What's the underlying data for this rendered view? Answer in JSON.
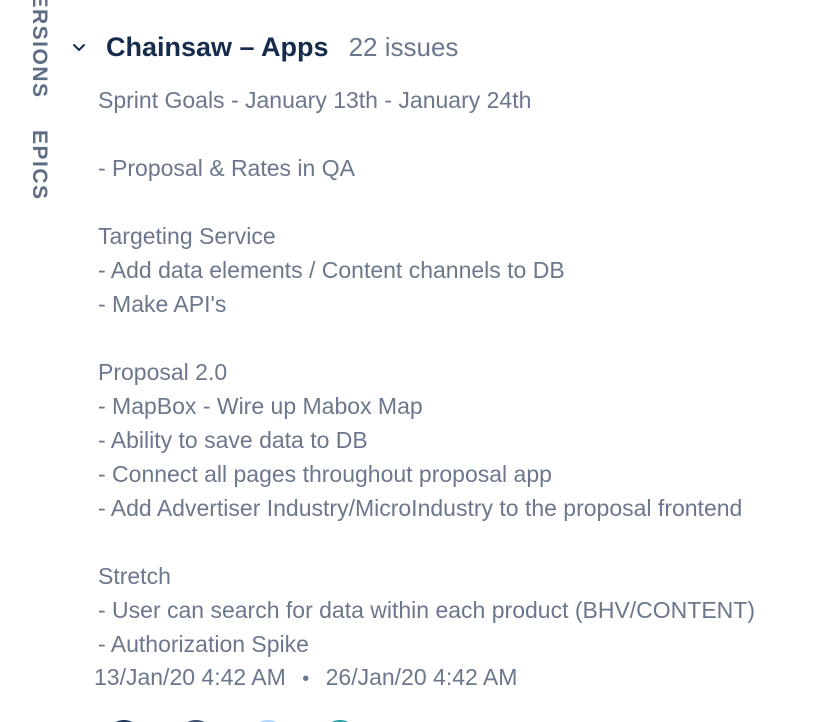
{
  "side_tabs": {
    "versions": "VERSIONS",
    "epics": "EPICS"
  },
  "sprint": {
    "name": "Chainsaw – Apps",
    "issue_count": "22 issues",
    "goal_lines": [
      "Sprint Goals - January 13th - January 24th",
      "",
      "- Proposal & Rates in QA",
      "",
      "Targeting Service",
      "- Add data elements / Content channels to DB",
      "- Make API's",
      "",
      "Proposal 2.0",
      "- MapBox - Wire up Mabox Map",
      "- Ability to save data to DB",
      "- Connect all pages throughout proposal app",
      "- Add Advertiser Industry/MicroIndustry to the proposal frontend",
      "",
      "Stretch",
      "- User can search for data within each product (BHV/CONTENT)",
      "- Authorization Spike"
    ],
    "start_date": "13/Jan/20 4:42 AM",
    "date_separator": "•",
    "end_date": "26/Jan/20 4:42 AM"
  },
  "avatars": [
    {
      "color": "#253858"
    },
    {
      "color": "#42526e"
    },
    {
      "color": "#b3d4ff"
    },
    {
      "color": "#2a9d9f"
    }
  ],
  "colors": {
    "title": "#172b4d",
    "muted": "#6b778c",
    "side_tab": "#5e6c84"
  }
}
